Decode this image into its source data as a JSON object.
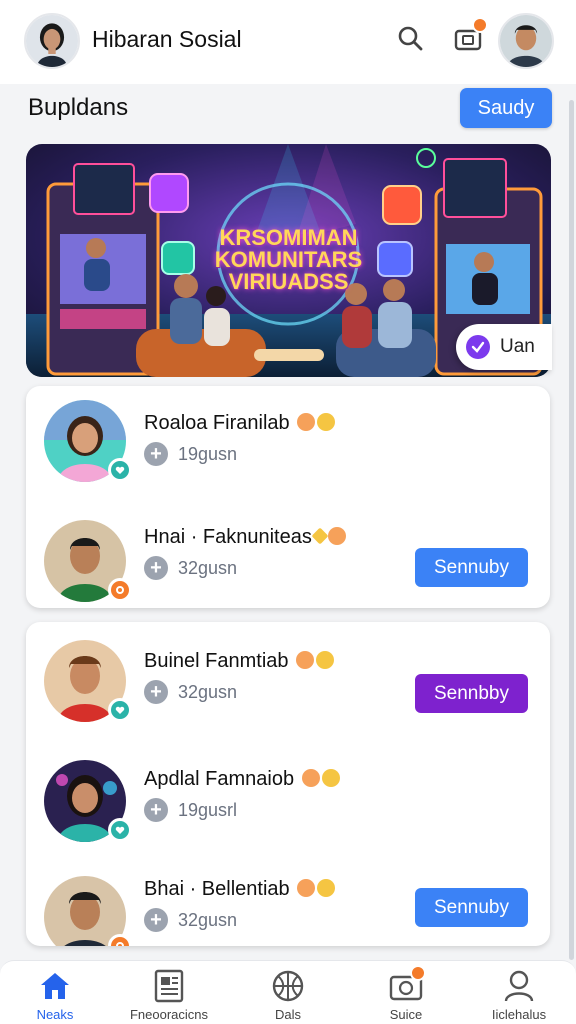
{
  "header": {
    "app_title": "Hibaran Sosial",
    "icons": [
      "search-icon",
      "notification-icon"
    ]
  },
  "section": {
    "title": "Bupldans",
    "action_label": "Saudy"
  },
  "banner": {
    "title_line1": "KRSOMIMAN",
    "title_line2": "KOMUNITARS",
    "title_line3": "VIRIUADSS",
    "chip_label": "Uan"
  },
  "cards": [
    {
      "people": [
        {
          "name": "Roaloa Firanilab",
          "meta": "19gusn",
          "status": "teal",
          "button": null
        },
        {
          "name": "Hnai · Faknuniteas",
          "meta": "32gusn",
          "status": "orange",
          "button": "Sennuby"
        }
      ]
    },
    {
      "people": [
        {
          "name": "Buinel Fanmtiab",
          "meta": "32gusn",
          "status": "teal",
          "button": "Sennbby"
        },
        {
          "name": "Apdlal Famnaiob",
          "meta": "19gusrl",
          "status": "teal",
          "button": null
        },
        {
          "name": "Bhai · Bellentiab",
          "meta": "32gusn",
          "status": "orange",
          "button": "Sennuby"
        }
      ]
    }
  ],
  "nav": [
    {
      "label": "Neaks",
      "icon": "home-icon",
      "active": true
    },
    {
      "label": "Fneooracicns",
      "icon": "news-icon",
      "active": false
    },
    {
      "label": "Dals",
      "icon": "ball-icon",
      "active": false
    },
    {
      "label": "Suice",
      "icon": "camera-icon",
      "active": false
    },
    {
      "label": "Iiclehalus",
      "icon": "profile-icon",
      "active": false
    }
  ],
  "colors": {
    "accent": "#3b82f6",
    "purple": "#7e22ce",
    "badge": "#f47b2a",
    "teal": "#2bb3a8"
  }
}
